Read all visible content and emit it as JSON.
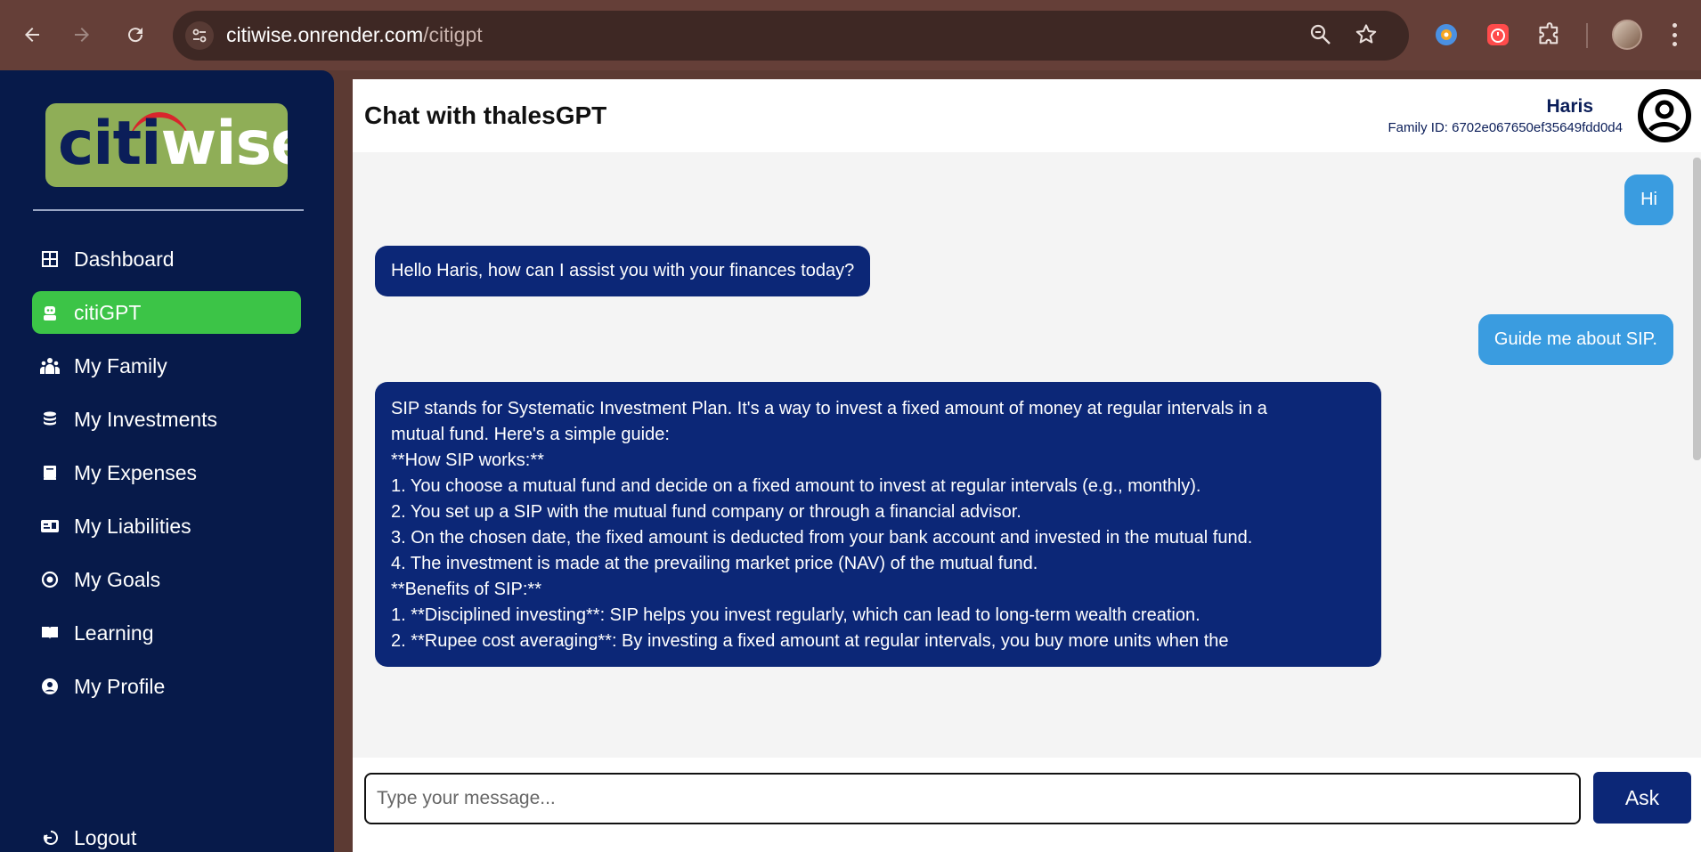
{
  "browser": {
    "url_host": "citiwise.onrender.com",
    "url_path": "/citigpt"
  },
  "sidebar": {
    "logo": {
      "part1": "citi",
      "part2": "wise"
    },
    "items": [
      {
        "label": "Dashboard",
        "icon": "grid-icon",
        "active": false
      },
      {
        "label": "citiGPT",
        "icon": "robot-icon",
        "active": true
      },
      {
        "label": "My Family",
        "icon": "family-icon",
        "active": false
      },
      {
        "label": "My Investments",
        "icon": "coins-icon",
        "active": false
      },
      {
        "label": "My Expenses",
        "icon": "receipt-icon",
        "active": false
      },
      {
        "label": "My Liabilities",
        "icon": "id-card-icon",
        "active": false
      },
      {
        "label": "My Goals",
        "icon": "target-icon",
        "active": false
      },
      {
        "label": "Learning",
        "icon": "book-icon",
        "active": false
      },
      {
        "label": "My Profile",
        "icon": "user-circle-icon",
        "active": false
      }
    ],
    "logout_label": "Logout"
  },
  "header": {
    "title": "Chat with thalesGPT",
    "user_name": "Haris",
    "family_id": "Family ID: 6702e067650ef35649fdd0d4"
  },
  "chat": {
    "messages": [
      {
        "role": "user",
        "lines": [
          "Hi"
        ]
      },
      {
        "role": "bot",
        "lines": [
          "Hello Haris, how can I assist you with your finances today?"
        ]
      },
      {
        "role": "user",
        "lines": [
          "Guide me about SIP."
        ]
      },
      {
        "role": "bot",
        "lines": [
          "SIP stands for Systematic Investment Plan. It's a way to invest a fixed amount of money at regular intervals in a",
          "mutual fund. Here's a simple guide:",
          "",
          "**How SIP works:**",
          "",
          "1. You choose a mutual fund and decide on a fixed amount to invest at regular intervals (e.g., monthly).",
          "2. You set up a SIP with the mutual fund company or through a financial advisor.",
          "3. On the chosen date, the fixed amount is deducted from your bank account and invested in the mutual fund.",
          "4. The investment is made at the prevailing market price (NAV) of the mutual fund.",
          "",
          "**Benefits of SIP:**",
          "",
          "1. **Disciplined investing**: SIP helps you invest regularly, which can lead to long-term wealth creation.",
          "2. **Rupee cost averaging**: By investing a fixed amount at regular intervals, you buy more units when the"
        ]
      }
    ]
  },
  "composer": {
    "placeholder": "Type your message...",
    "ask_label": "Ask"
  },
  "colors": {
    "sidebar_bg": "#071a4a",
    "active_nav": "#3cc447",
    "bot_bubble": "#0c2777",
    "user_bubble": "#3a9ce0"
  }
}
